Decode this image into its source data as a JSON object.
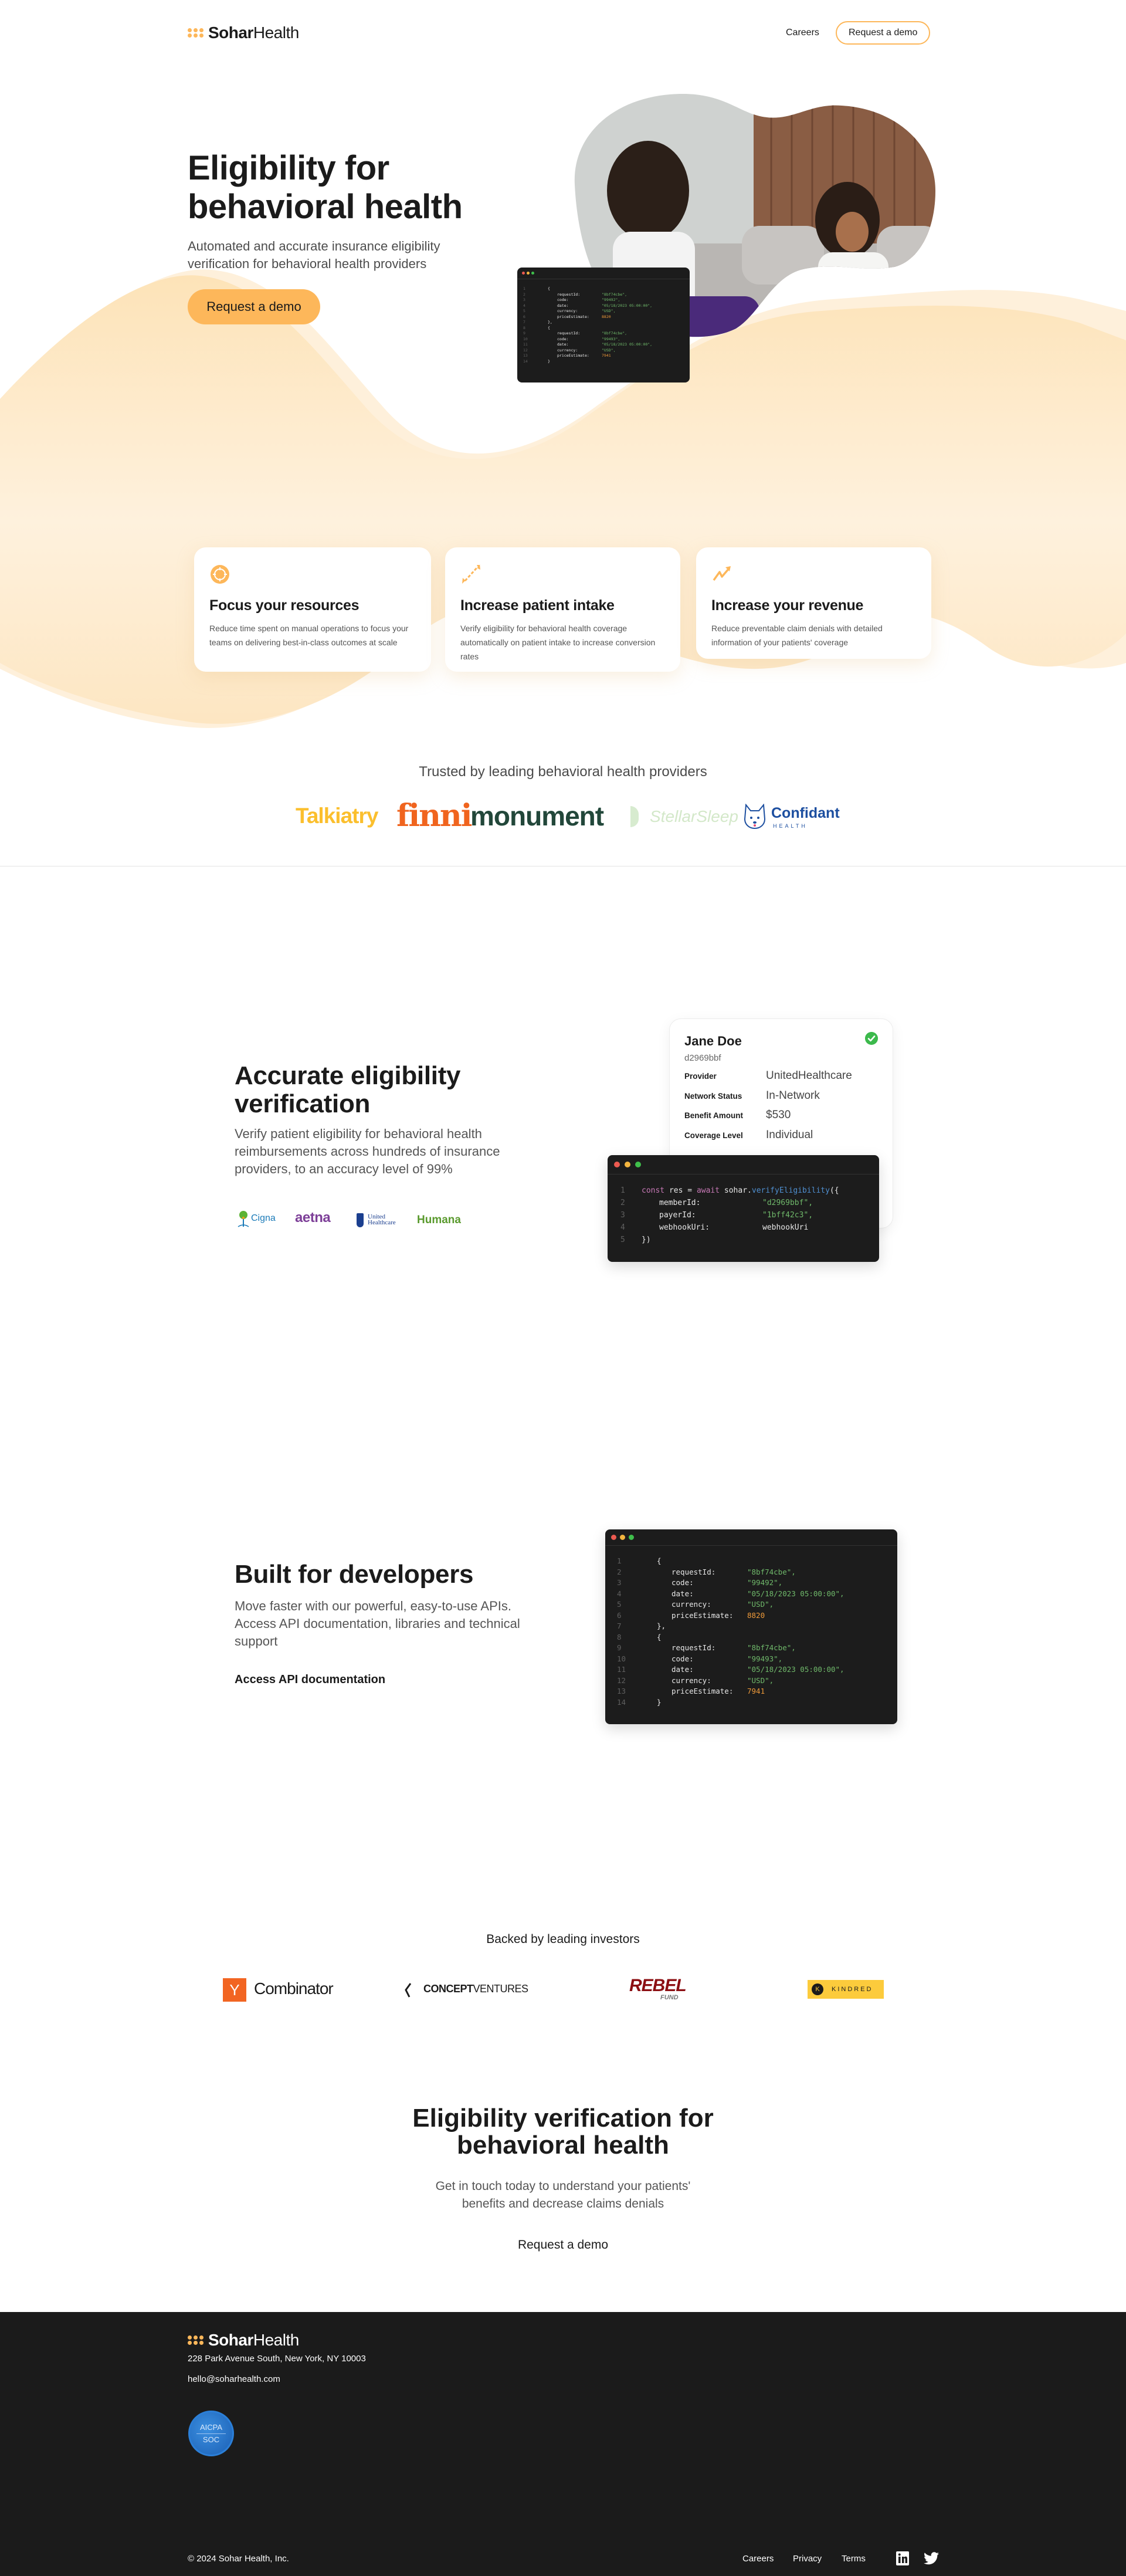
{
  "nav": {
    "brand_bold": "Sohar",
    "brand_light": "Health",
    "careers": "Careers",
    "cta": "Request a demo"
  },
  "hero": {
    "title_line1": "Eligibility for",
    "title_line2": "behavioral health",
    "subtitle": "Automated and accurate insurance eligibility verification for behavioral health providers",
    "cta": "Request a demo",
    "image_alt": "therapist-and-patient-photo"
  },
  "response_code": {
    "lines": [
      {
        "n": "1",
        "indent": 0,
        "text": "{"
      },
      {
        "n": "2",
        "indent": 1,
        "key": "requestId:",
        "val": "\"8bf74cbe\",",
        "type": "str"
      },
      {
        "n": "3",
        "indent": 1,
        "key": "code:",
        "val": "\"99492\",",
        "type": "str"
      },
      {
        "n": "4",
        "indent": 1,
        "key": "date:",
        "val": "\"05/18/2023 05:00:00\",",
        "type": "str"
      },
      {
        "n": "5",
        "indent": 1,
        "key": "currency:",
        "val": "\"USD\",",
        "type": "str"
      },
      {
        "n": "6",
        "indent": 1,
        "key": "priceEstimate:",
        "val": "8820",
        "type": "num"
      },
      {
        "n": "7",
        "indent": 0,
        "text": "},"
      },
      {
        "n": "8",
        "indent": 0,
        "text": "{"
      },
      {
        "n": "9",
        "indent": 1,
        "key": "requestId:",
        "val": "\"8bf74cbe\",",
        "type": "str"
      },
      {
        "n": "10",
        "indent": 1,
        "key": "code:",
        "val": "\"99493\",",
        "type": "str"
      },
      {
        "n": "11",
        "indent": 1,
        "key": "date:",
        "val": "\"05/18/2023 05:00:00\",",
        "type": "str"
      },
      {
        "n": "12",
        "indent": 1,
        "key": "currency:",
        "val": "\"USD\",",
        "type": "str"
      },
      {
        "n": "13",
        "indent": 1,
        "key": "priceEstimate:",
        "val": "7941",
        "type": "num"
      },
      {
        "n": "14",
        "indent": 0,
        "text": "}"
      }
    ]
  },
  "features": [
    {
      "icon": "target-icon",
      "title": "Focus your resources",
      "desc": "Reduce time spent on manual operations to focus your teams on delivering best-in-class outcomes at scale"
    },
    {
      "icon": "expand-arrows-icon",
      "title": "Increase patient intake",
      "desc": "Verify eligibility for behavioral health coverage automatically on patient intake to increase conversion rates"
    },
    {
      "icon": "trend-up-icon",
      "title": "Increase your revenue",
      "desc": "Reduce preventable claim denials with detailed information of your patients' coverage"
    }
  ],
  "trusted": {
    "title": "Trusted by leading behavioral health providers",
    "logos": [
      {
        "name": "Talkiatry",
        "color": "#fbbf2d"
      },
      {
        "name": "finni",
        "color": "#f0641e"
      },
      {
        "name": "monument",
        "color": "#22473a"
      },
      {
        "name": "StellarSleep",
        "color": "#cfe6c6"
      },
      {
        "name": "Confidant",
        "sub": "HEALTH",
        "color": "#1d4fa0"
      }
    ]
  },
  "accurate": {
    "title_line1": "Accurate eligibility",
    "title_line2": "verification",
    "subtitle": "Verify patient eligibility for behavioral health reimbursements across hundreds of insurance providers, to an accuracy level of 99%",
    "payers": [
      {
        "name": "Cigna",
        "color": "#1a7ab8"
      },
      {
        "name": "aetna",
        "color": "#7d3f98"
      },
      {
        "name": "United Healthcare",
        "line1": "United",
        "line2": "Healthcare",
        "color": "#1b3f8f"
      },
      {
        "name": "Humana",
        "color": "#5a9a2e"
      }
    ],
    "patient": {
      "name": "Jane Doe",
      "id": "d2969bbf",
      "verified_icon": "check-circle-icon",
      "rows": [
        {
          "label": "Provider",
          "value": "UnitedHealthcare"
        },
        {
          "label": "Network Status",
          "value": "In-Network"
        },
        {
          "label": "Benefit Amount",
          "value": "$530"
        },
        {
          "label": "Coverage Level",
          "value": "Individual"
        }
      ]
    },
    "code": {
      "line1": {
        "n": "1",
        "kw1": "const",
        "var": " res = ",
        "kw2": "await",
        "obj": " sohar.",
        "fn": "verifyEligibility",
        "end": "({"
      },
      "args": [
        {
          "n": "2",
          "key": "memberId:",
          "val": "\"d2969bbf\",",
          "type": "str"
        },
        {
          "n": "3",
          "key": "payerId:",
          "val": "\"1bff42c3\",",
          "type": "str"
        },
        {
          "n": "4",
          "key": "webhookUri:",
          "val": "webhookUri",
          "type": "plain"
        }
      ],
      "close": {
        "n": "5",
        "text": "})"
      }
    }
  },
  "developers": {
    "title": "Built for developers",
    "subtitle": "Move faster with our powerful, easy-to-use APIs. Access API documentation, libraries and technical support",
    "link": "Access API documentation"
  },
  "investors": {
    "title": "Backed by leading investors",
    "logos": [
      {
        "name": "Y Combinator",
        "mark": "Y",
        "text": "Combinator"
      },
      {
        "name": "Concept Ventures",
        "bold": "CONCEPT",
        "light": "VENTURES"
      },
      {
        "name": "Rebel Fund",
        "top": "REBEL",
        "bottom": "FUND"
      },
      {
        "name": "Kindred",
        "mark": "K",
        "text": "KINDRED"
      }
    ]
  },
  "final_cta": {
    "title_line1": "Eligibility verification for",
    "title_line2": "behavioral health",
    "subtitle_line1": "Get in touch today to understand your patients'",
    "subtitle_line2": "benefits and decrease claims denials",
    "cta": "Request a demo"
  },
  "footer": {
    "brand_bold": "Sohar",
    "brand_light": "Health",
    "address": "228 Park Avenue South, New York, NY 10003",
    "email": "hello@soharhealth.com",
    "badge_line1": "AICPA",
    "badge_line2": "SOC",
    "copyright": "© 2024 Sohar Health, Inc.",
    "links": [
      "Careers",
      "Privacy",
      "Terms"
    ],
    "social": [
      "linkedin-icon",
      "twitter-icon"
    ]
  },
  "colors": {
    "accent": "#fdb75a",
    "dark": "#1b1b1b",
    "wave": "#fde8c6",
    "success": "#3cb94c"
  }
}
